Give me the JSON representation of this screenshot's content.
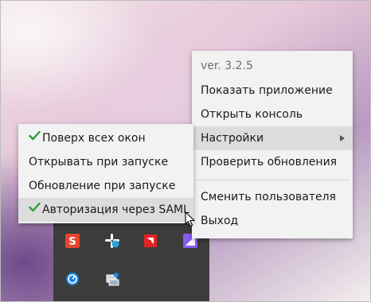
{
  "main_menu": {
    "version": "ver. 3.2.5",
    "show_app": "Показать приложение",
    "open_console": "Открыть консоль",
    "settings": "Настройки",
    "check_updates": "Проверить обновления",
    "switch_user": "Сменить пользователя",
    "exit": "Выход"
  },
  "settings_submenu": {
    "always_on_top": {
      "label": "Поверх всех окон",
      "checked": true
    },
    "open_on_startup": {
      "label": "Открывать при запуске",
      "checked": false
    },
    "update_on_startup": {
      "label": "Обновление при запуске",
      "checked": false
    },
    "saml_auth": {
      "label": "Авторизация через SAML",
      "checked": true
    }
  },
  "tray_icons": [
    "s-app-icon",
    "slack-icon",
    "amd-icon",
    "kotlin-k-icon",
    "clock-app-icon",
    "network-tool-icon"
  ],
  "colors": {
    "check": "#2f9e2f",
    "menu_bg": "#f2f2f2",
    "highlight": "#dcdcdc",
    "tray_bg": "#3c3c3c"
  }
}
